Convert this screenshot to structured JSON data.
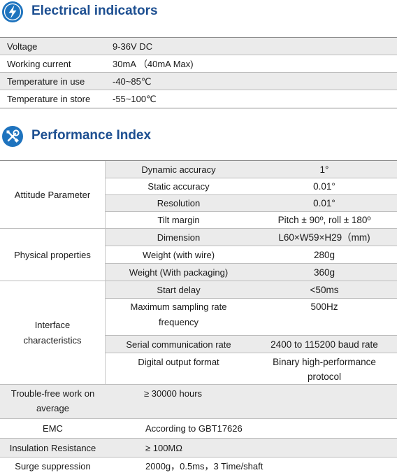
{
  "electrical": {
    "title": "Electrical indicators",
    "rows": [
      {
        "label": "Voltage",
        "value": "9-36V DC"
      },
      {
        "label": "Working current",
        "value": "30mA （40mA Max)"
      },
      {
        "label": "Temperature in use",
        "value": "-40~85℃"
      },
      {
        "label": "Temperature in store",
        "value": "-55~100℃"
      }
    ]
  },
  "performance": {
    "title": "Performance Index",
    "attitude": {
      "group": "Attitude Parameter",
      "rows": [
        {
          "name": "Dynamic accuracy",
          "value": "1°"
        },
        {
          "name": "Static accuracy",
          "value": "0.01°"
        },
        {
          "name": "Resolution",
          "value": "0.01°"
        },
        {
          "name": "Tilt margin",
          "value": "Pitch ± 90º, roll ± 180º"
        }
      ]
    },
    "physical": {
      "group": "Physical properties",
      "rows": [
        {
          "name": "Dimension",
          "value": "L60×W59×H29（mm)"
        },
        {
          "name": "Weight (with wire)",
          "value": "280g"
        },
        {
          "name": "Weight (With packaging)",
          "value": "360g"
        }
      ]
    },
    "interface": {
      "group_line1": "Interface",
      "group_line2": "characteristics",
      "rows": [
        {
          "name": "Start delay",
          "value": "<50ms"
        },
        {
          "name_line1": "Maximum sampling rate",
          "name_line2": "frequency",
          "value": "500Hz"
        },
        {
          "name": "Serial communication rate",
          "value": "2400 to 115200 baud rate"
        },
        {
          "name": "Digital output format",
          "value_line1": "Binary high-performance",
          "value_line2": "protocol"
        }
      ]
    },
    "misc": [
      {
        "label_line1": "Trouble-free work on",
        "label_line2": "average",
        "value": "≥ 30000 hours"
      },
      {
        "label": "EMC",
        "value": "According to GBT17626"
      },
      {
        "label": "Insulation Resistance",
        "value": "≥ 100MΩ"
      },
      {
        "label": "Surge suppression",
        "value": "2000g，0.5ms，3 Time/shaft"
      }
    ]
  },
  "icons": {
    "electrical": "lightning-bolt-icon",
    "performance": "wrench-screwdriver-icon"
  },
  "colors": {
    "accent": "#1e73be",
    "heading": "#1d4f91",
    "row_shade": "#ebebeb",
    "rule": "#bdbdbd"
  }
}
